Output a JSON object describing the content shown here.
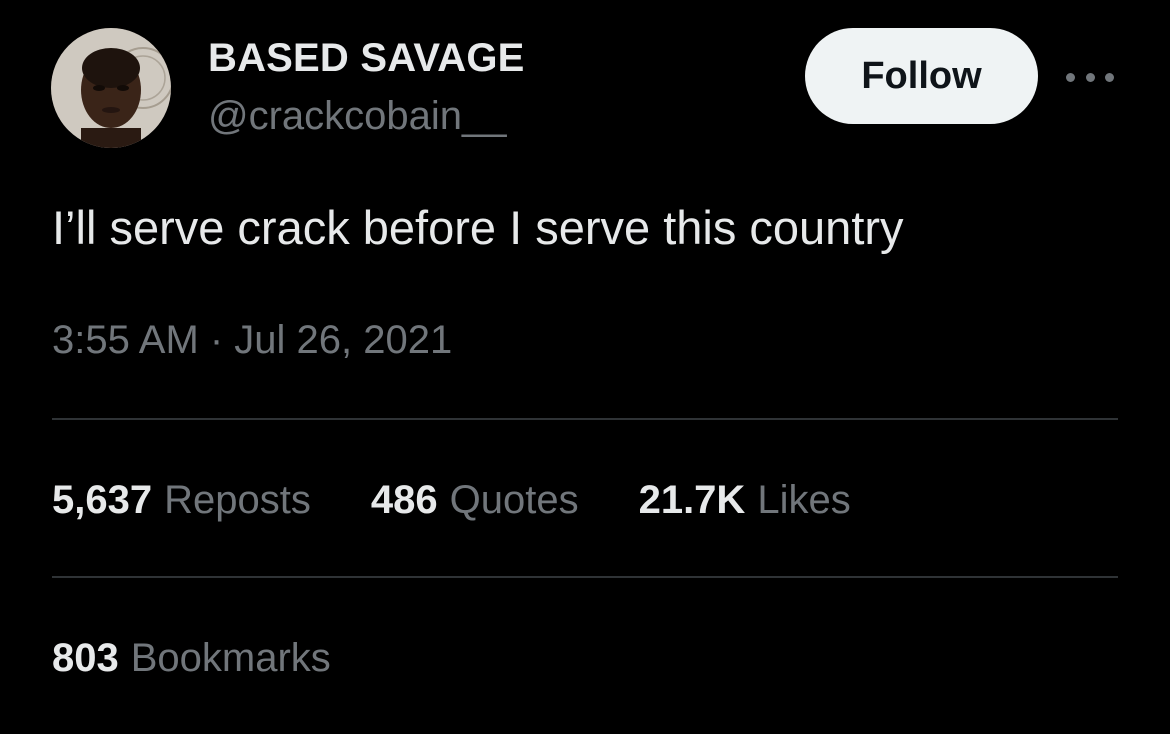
{
  "author": {
    "display_name": "BASED SAVAGE",
    "handle": "@crackcobain__"
  },
  "follow_label": "Follow",
  "more_icon": "ellipsis-icon",
  "tweet": {
    "text": "I’ll serve crack before I serve this country",
    "timestamp": "3:55 AM · Jul 26, 2021"
  },
  "stats": [
    {
      "count": "5,637",
      "label": "Reposts"
    },
    {
      "count": "486",
      "label": "Quotes"
    },
    {
      "count": "21.7K",
      "label": "Likes"
    }
  ],
  "bookmarks": {
    "count": "803",
    "label": "Bookmarks"
  },
  "colors": {
    "background": "#000000",
    "primary_text": "#e7e9ea",
    "secondary_text": "#71767b",
    "divider": "#2f3336",
    "follow_button_bg": "#eff3f4"
  }
}
